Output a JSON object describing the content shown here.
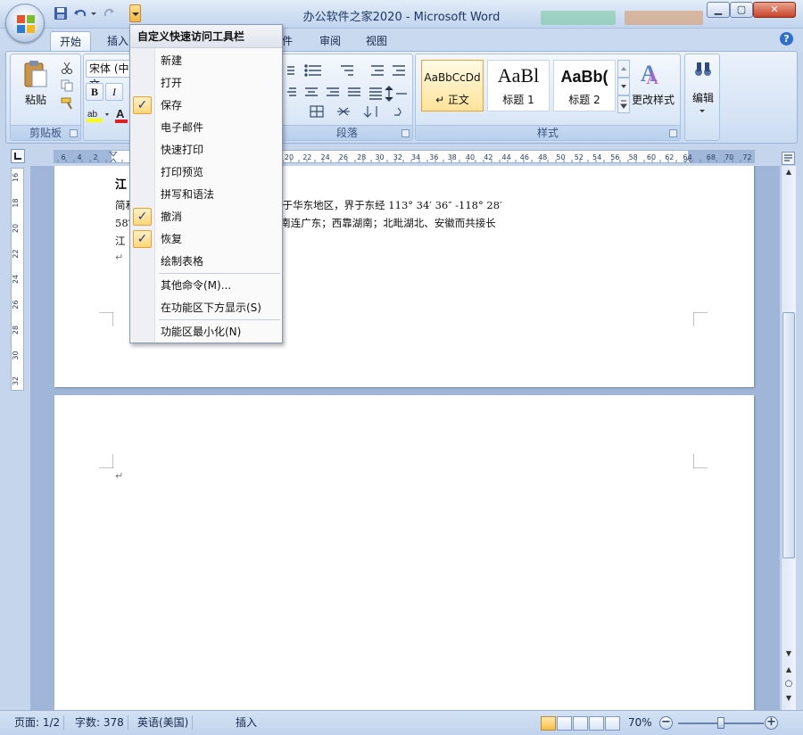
{
  "window": {
    "title": "办公软件之家2020 - Microsoft Word",
    "minimize": "▁",
    "maximize": "▢",
    "close": "✕"
  },
  "tabs": [
    "开始",
    "插入",
    "件",
    "审阅",
    "视图"
  ],
  "help": "?",
  "ribbon": {
    "clipboard": {
      "paste": "粘贴",
      "label": "剪贴板"
    },
    "font": {
      "name": "宋体 (中文",
      "bold": "B",
      "italic": "I"
    },
    "paragraph": {
      "label": "段落"
    },
    "styles": {
      "label": "样式",
      "items": [
        {
          "sample": "AaBbCcDd",
          "name": "↵ 正文"
        },
        {
          "sample": "AaBl",
          "name": "标题 1"
        },
        {
          "sample": "AaBb(",
          "name": "标题 2"
        }
      ],
      "change_styles": "更改样式"
    },
    "editing": {
      "label": "编辑"
    }
  },
  "ruler": {
    "left_labels": [
      "6",
      "4",
      "2"
    ],
    "right_labels": [
      "20",
      "22",
      "24",
      "26",
      "28",
      "30",
      "32",
      "34",
      "36",
      "38",
      "40",
      "42",
      "44",
      "46",
      "48",
      "50",
      "52",
      "54",
      "56",
      "58",
      "60",
      "62",
      "64",
      "68",
      "70",
      "72"
    ],
    "vertical_labels": [
      "16",
      "18",
      "20",
      "22",
      "24",
      "26",
      "28",
      "30",
      "32"
    ]
  },
  "document": {
    "heading": "江",
    "line1": "简和                              国东南部，长江中下游南岸，属于华东地区，界于东经 113° 34′ 36″ -118° 28′",
    "line2": "58″                              4′ 41″ 之间，东邻浙江、福建；南连广东；西靠湖南；北毗湖北、安徽而共接长",
    "line3": "江",
    "para_mark": "↵"
  },
  "qat_menu": {
    "title": "自定义快速访问工具栏",
    "items": [
      {
        "label": "新建",
        "checked": false
      },
      {
        "label": "打开",
        "checked": false
      },
      {
        "label": "保存",
        "checked": true
      },
      {
        "label": "电子邮件",
        "checked": false
      },
      {
        "label": "快速打印",
        "checked": false
      },
      {
        "label": "打印预览",
        "checked": false
      },
      {
        "label": "拼写和语法",
        "checked": false
      },
      {
        "label": "撤消",
        "checked": true
      },
      {
        "label": "恢复",
        "checked": true
      },
      {
        "label": "绘制表格",
        "checked": false
      }
    ],
    "more_commands": "其他命令(M)...",
    "show_below": "在功能区下方显示(S)",
    "minimize_ribbon": "功能区最小化(N)",
    "check_glyph": "✓"
  },
  "status": {
    "page": "页面: 1/2",
    "words": "字数: 378",
    "language": "英语(美国)",
    "mode": "插入",
    "zoom": "70%",
    "zoom_level": 0.5,
    "zoom_minus": "−",
    "zoom_plus": "+"
  },
  "colors": {
    "accent": "#f7b640",
    "ribbon": "#d6e4f5",
    "doc_background": "#9fb6d8",
    "highlight": "#ffd67a"
  }
}
